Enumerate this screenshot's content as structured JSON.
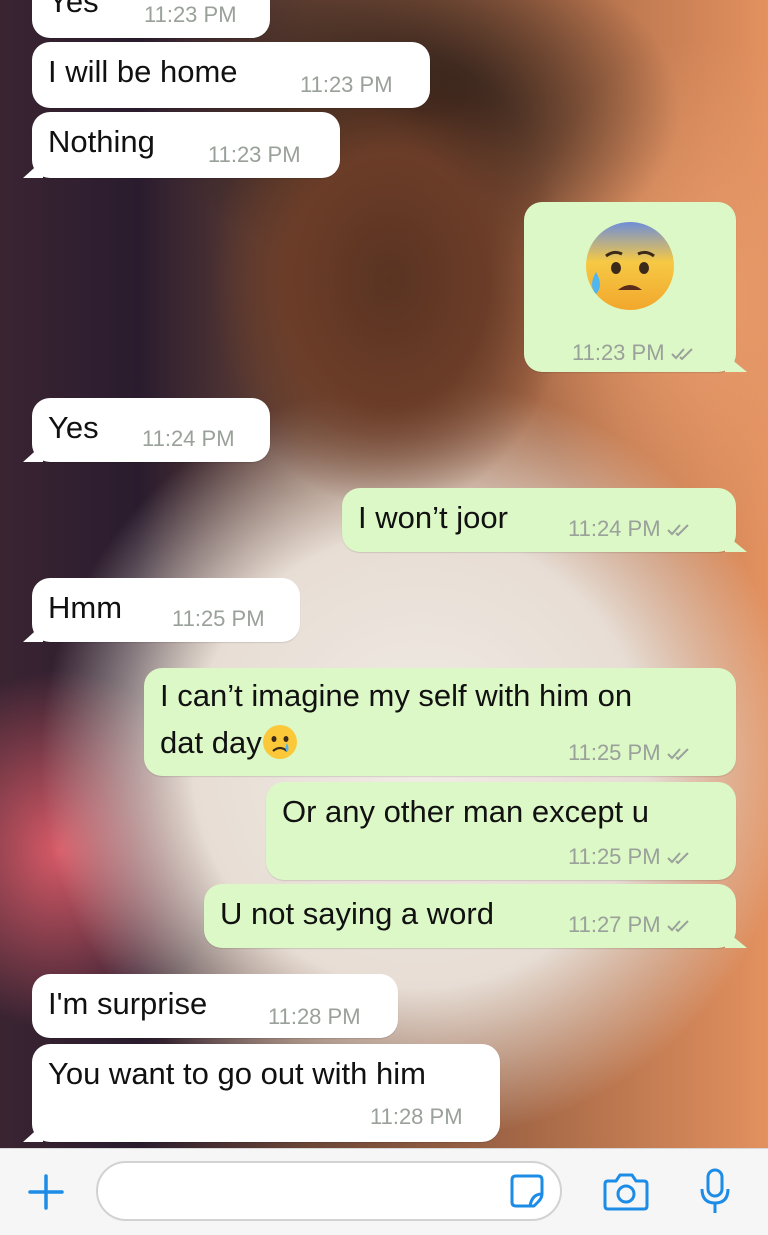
{
  "messages": [
    {
      "text": "Yes",
      "time": "11:23 PM",
      "direction": "in"
    },
    {
      "text": "I will be home",
      "time": "11:23 PM",
      "direction": "in"
    },
    {
      "text": "Nothing",
      "time": "11:23 PM",
      "direction": "in"
    },
    {
      "emoji": "anxious-face-with-sweat",
      "time": "11:23 PM",
      "direction": "out",
      "status": "read"
    },
    {
      "text": "Yes",
      "time": "11:24 PM",
      "direction": "in"
    },
    {
      "text": "I won’t joor",
      "time": "11:24 PM",
      "direction": "out",
      "status": "read"
    },
    {
      "text": "Hmm",
      "time": "11:25 PM",
      "direction": "in"
    },
    {
      "text_line1": "I can’t imagine my self with him on",
      "text_line2": "dat day",
      "emoji": "crying-face",
      "time": "11:25 PM",
      "direction": "out",
      "status": "read"
    },
    {
      "text": "Or any other man except u",
      "time": "11:25 PM",
      "direction": "out",
      "status": "read"
    },
    {
      "text": "U not saying a word",
      "time": "11:27 PM",
      "direction": "out",
      "status": "read"
    },
    {
      "text": "I'm surprise",
      "time": "11:28 PM",
      "direction": "in"
    },
    {
      "text": "You want to go out with him",
      "time": "11:28 PM",
      "direction": "in"
    }
  ],
  "input_bar": {
    "plus_icon": "plus-icon",
    "message_value": "",
    "sticker_icon": "sticker-icon",
    "camera_icon": "camera-icon",
    "mic_icon": "microphone-icon"
  },
  "colors": {
    "incoming_bubble": "#ffffff",
    "outgoing_bubble": "#dcf8c6",
    "accent": "#1c8ce6",
    "timestamp": "#9aa09a",
    "read_ticks": "#9aa09a"
  }
}
